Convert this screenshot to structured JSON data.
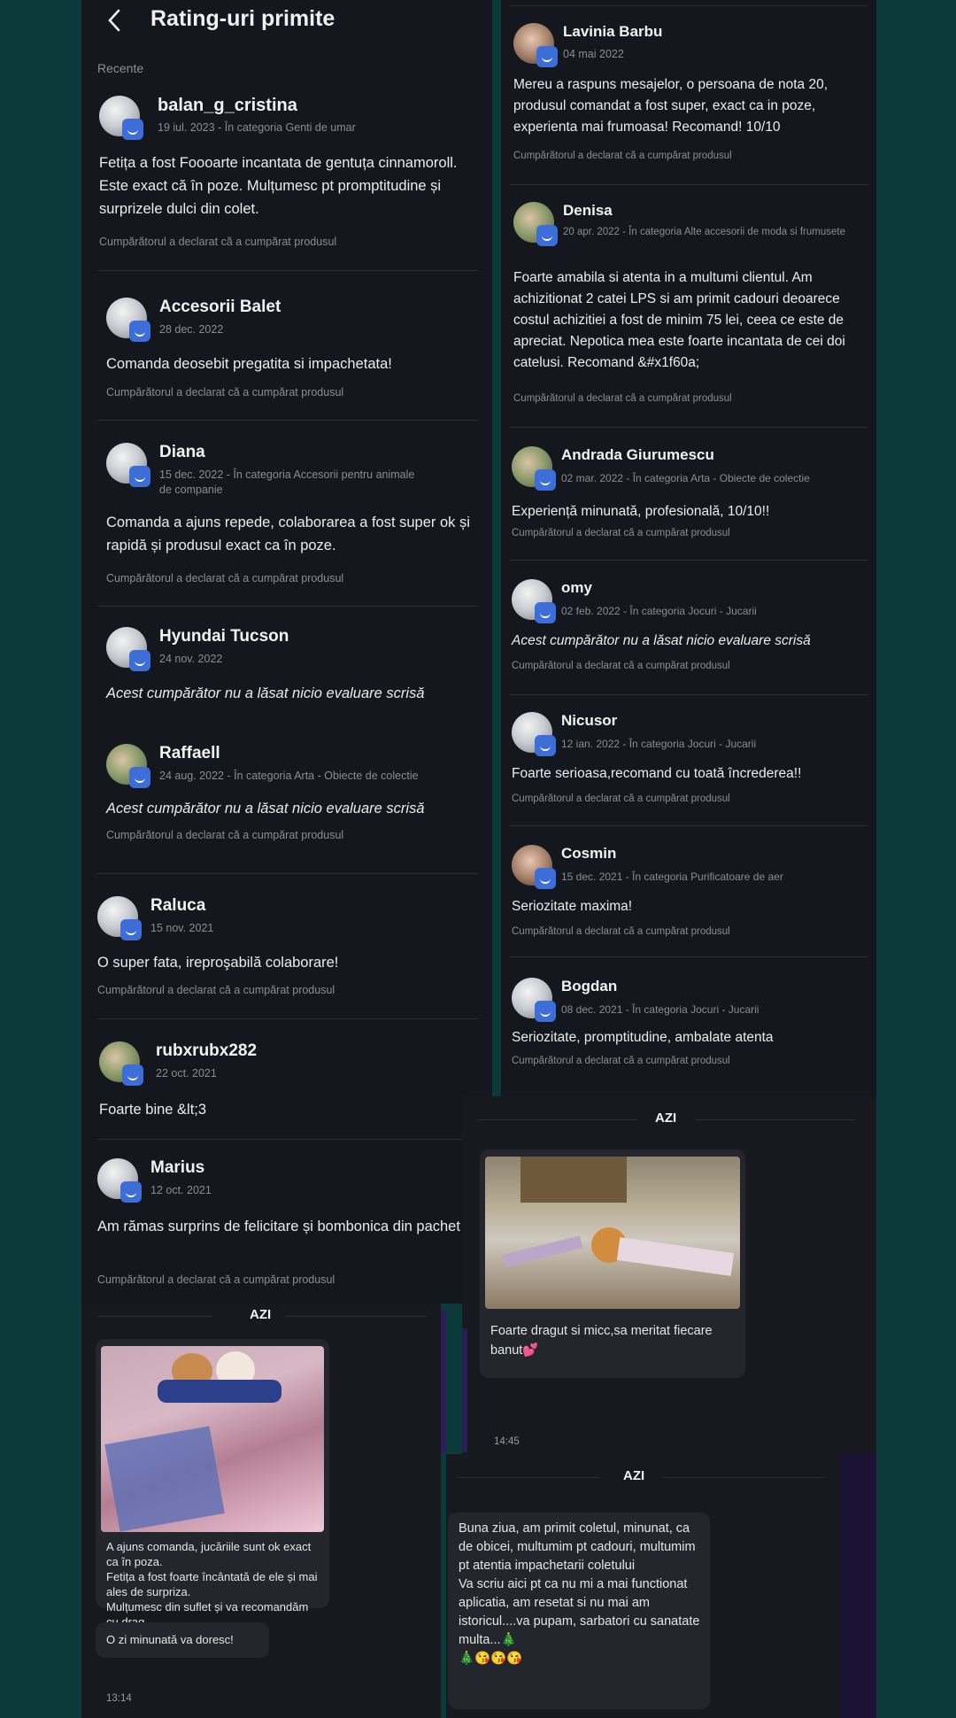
{
  "header": {
    "title": "Rating-uri primite",
    "section": "Recente"
  },
  "footer_text": "Cumpărătorul a declarat că a cumpărat produsul",
  "left_reviews": [
    {
      "name": "balan_g_cristina",
      "meta": "19 iul. 2023 - În categoria Genti de umar",
      "text": "Fetița a fost Foooarte incantata de gentuța cinnamoroll. Este exact că în poze. Mulțumesc pt promptitudine și surprizele dulci din colet.",
      "footer": "Cumpărătorul a declarat că a cumpărat produsul"
    },
    {
      "name": "Accesorii Balet",
      "meta": "28 dec. 2022",
      "text": "Comanda deosebit pregatita si impachetata!",
      "footer": "Cumpărătorul a declarat că a cumpărat produsul"
    },
    {
      "name": "Diana",
      "meta": "15 dec. 2022 - În categoria Accesorii pentru animale de companie",
      "text": "Comanda a ajuns repede, colaborarea a fost super ok și rapidă și produsul exact ca în poze.",
      "footer": "Cumpărătorul a declarat că a cumpărat produsul"
    },
    {
      "name": "Hyundai Tucson",
      "meta": "24 nov. 2022",
      "text": "Acest cumpărător nu a lăsat nicio evaluare scrisă",
      "footer": ""
    },
    {
      "name": "Raffaell",
      "meta": "24 aug. 2022 - În categoria Arta - Obiecte de colectie",
      "text": "Acest cumpărător nu a lăsat nicio evaluare scrisă",
      "footer": "Cumpărătorul a declarat că a cumpărat produsul"
    },
    {
      "name": "Raluca",
      "meta": "15 nov. 2021",
      "text": "O super fata,  ireproşabilă colaborare!",
      "footer": "Cumpărătorul a declarat că a cumpărat produsul"
    },
    {
      "name": "rubxrubx282",
      "meta": "22 oct. 2021",
      "text": "Foarte bine &lt;3",
      "footer": ""
    },
    {
      "name": "Marius",
      "meta": "12 oct. 2021",
      "text": "Am rămas surprins de felicitare și bombonica din pachet",
      "footer": "Cumpărătorul a declarat că a cumpărat produsul"
    }
  ],
  "right_reviews": [
    {
      "name": "Lavinia Barbu",
      "meta": "04 mai 2022",
      "text": "Mereu a raspuns mesajelor, o persoana de nota 20, produsul comandat a fost super, exact ca in poze, experienta mai frumoasa! Recomand! 10/10",
      "footer": "Cumpărătorul a declarat că a cumpărat produsul"
    },
    {
      "name": "Denisa",
      "meta": "20 apr. 2022 - În categoria Alte accesorii de moda si frumusete",
      "text": "Foarte amabila si atenta in a multumi clientul. Am achizitionat 2 catei LPS si am primit cadouri deoarece costul achizitiei a fost de minim 75 lei, ceea ce este de apreciat. Nepotica mea este foarte incantata de cei doi catelusi. Recomand &#x1f60a;",
      "footer": "Cumpărătorul a declarat că a cumpărat produsul"
    },
    {
      "name": "Andrada Giurumescu",
      "meta": "02 mar. 2022 - În categoria Arta - Obiecte de colectie",
      "text": "Experiență minunată, profesională, 10/10!!",
      "footer": "Cumpărătorul a declarat că a cumpărat produsul"
    },
    {
      "name": "omy",
      "meta": "02 feb. 2022 - În categoria Jocuri - Jucarii",
      "text": "Acest cumpărător nu a lăsat nicio evaluare scrisă",
      "footer": "Cumpărătorul a declarat că a cumpărat produsul"
    },
    {
      "name": "Nicusor",
      "meta": "12 ian. 2022 - În categoria Jocuri - Jucarii",
      "text": "Foarte serioasa,recomand cu toată încrederea!!",
      "footer": "Cumpărătorul a declarat că a cumpărat produsul"
    },
    {
      "name": "Cosmin",
      "meta": "15 dec. 2021 - În categoria Purificatoare de aer",
      "text": "Seriozitate maxima!",
      "footer": "Cumpărătorul a declarat că a cumpărat produsul"
    },
    {
      "name": "Bogdan",
      "meta": "08 dec. 2021 - În categoria Jocuri - Jucarii",
      "text": "Seriozitate, promptitudine, ambalate atenta",
      "footer": "Cumpărătorul a declarat că a cumpărat produsul"
    }
  ],
  "chat1": {
    "day": "AZI",
    "message": "A ajuns comanda, jucăriile sunt ok exact ca în poza.\n Fetița a fost foarte încântată de ele și mai ales de surpriza.\nMulțumesc din suflet și va recomandăm cu drag",
    "message2": "O zi minunată va doresc!",
    "time": "13:14"
  },
  "chat2": {
    "day": "AZI",
    "message": "Foarte dragut si micc,sa meritat fiecare banut💕",
    "time": "14:45"
  },
  "chat3": {
    "day": "AZI",
    "message": "Buna ziua, am primit coletul, minunat, ca de obicei, multumim pt cadouri, multumim pt atentia impachetarii coletului\nVa scriu aici pt ca nu mi a mai functionat aplicatia, am resetat si nu mai am istoricul....va pupam, sarbatori cu sanatate multa...🎄\n🎄😘😘😘"
  },
  "colors": {
    "background": "#0c3a3b",
    "panel": "#14171e",
    "badge": "#3d6ed8"
  }
}
